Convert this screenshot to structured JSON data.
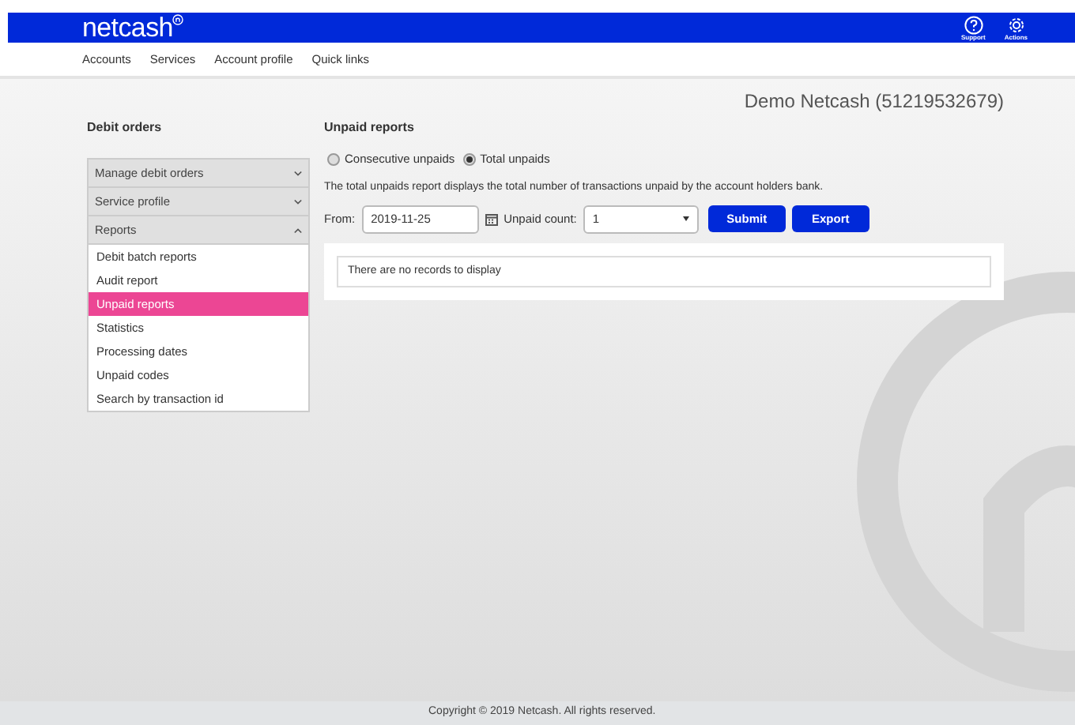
{
  "header": {
    "logo": "netcash",
    "actions": [
      {
        "kind": "help",
        "label": "Support"
      },
      {
        "kind": "gear",
        "label": "Actions"
      }
    ]
  },
  "nav": [
    "Accounts",
    "Services",
    "Account profile",
    "Quick links"
  ],
  "account_name": "Demo Netcash (51219532679)",
  "sidebar": {
    "title": "Debit orders",
    "sections": [
      {
        "label": "Manage debit orders",
        "expanded": false
      },
      {
        "label": "Service profile",
        "expanded": false
      },
      {
        "label": "Reports",
        "expanded": true,
        "items": [
          {
            "label": "Debit batch reports",
            "selected": false
          },
          {
            "label": "Audit report",
            "selected": false
          },
          {
            "label": "Unpaid reports",
            "selected": true
          },
          {
            "label": "Statistics",
            "selected": false
          },
          {
            "label": "Processing dates",
            "selected": false
          },
          {
            "label": "Unpaid codes",
            "selected": false
          },
          {
            "label": "Search by transaction id",
            "selected": false
          }
        ]
      }
    ]
  },
  "main": {
    "title": "Unpaid reports",
    "radios": [
      {
        "label": "Consecutive unpaids",
        "selected": false
      },
      {
        "label": "Total unpaids",
        "selected": true
      }
    ],
    "description": "The total unpaids report displays the total number of transactions unpaid by the account holders bank.",
    "from_label": "From:",
    "from_value": "2019-11-25",
    "count_label": "Unpaid count:",
    "count_value": "1",
    "buttons": [
      "Submit",
      "Export"
    ],
    "empty_message": "There are no records to display"
  },
  "footer": "Copyright © 2019 Netcash. All rights reserved."
}
